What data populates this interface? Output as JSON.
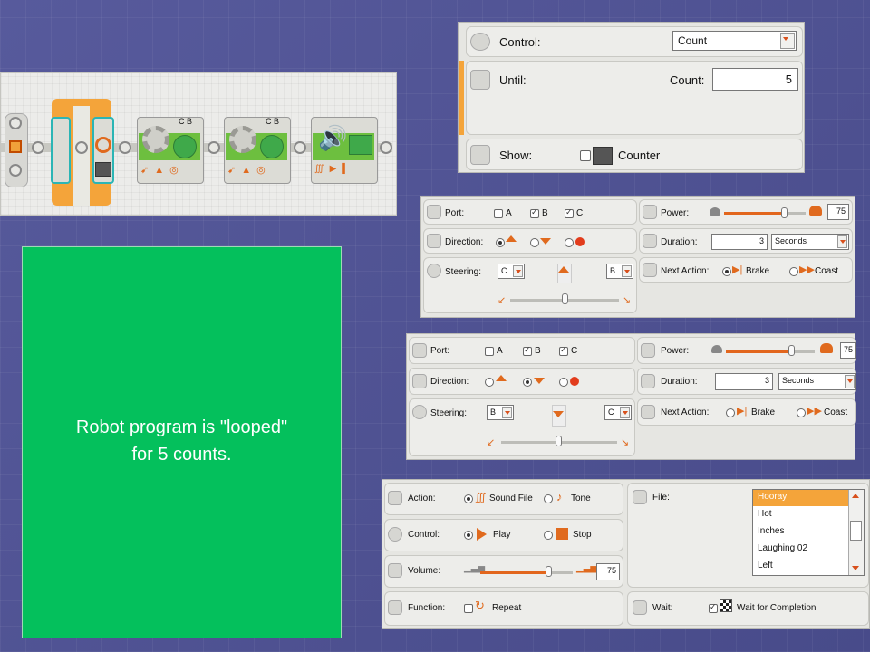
{
  "program": {
    "loop_sensor_ports": "C B",
    "move2_ports": "C B"
  },
  "loop_panel": {
    "control_label": "Control:",
    "control_value": "Count",
    "until_label": "Until:",
    "count_label": "Count:",
    "count_value": "5",
    "show_label": "Show:",
    "counter_label": "Counter"
  },
  "move1": {
    "port_label": "Port:",
    "ports": [
      "A",
      "B",
      "C"
    ],
    "power_label": "Power:",
    "power_value": "75",
    "direction_label": "Direction:",
    "duration_label": "Duration:",
    "duration_value": "3",
    "duration_unit": "Seconds",
    "steering_label": "Steering:",
    "steer_left": "C",
    "steer_right": "B",
    "next_action_label": "Next Action:",
    "brake_label": "Brake",
    "coast_label": "Coast"
  },
  "move2": {
    "port_label": "Port:",
    "ports": [
      "A",
      "B",
      "C"
    ],
    "power_label": "Power:",
    "power_value": "75",
    "direction_label": "Direction:",
    "duration_label": "Duration:",
    "duration_value": "3",
    "duration_unit": "Seconds",
    "steering_label": "Steering:",
    "steer_left": "B",
    "steer_right": "C",
    "next_action_label": "Next Action:",
    "brake_label": "Brake",
    "coast_label": "Coast"
  },
  "sound": {
    "action_label": "Action:",
    "sound_file_label": "Sound File",
    "tone_label": "Tone",
    "control_label": "Control:",
    "play_label": "Play",
    "stop_label": "Stop",
    "volume_label": "Volume:",
    "volume_value": "75",
    "function_label": "Function:",
    "repeat_label": "Repeat",
    "file_label": "File:",
    "files": [
      "Hooray",
      "Hot",
      "Inches",
      "Laughing 02",
      "Left"
    ],
    "wait_label": "Wait:",
    "wait_for_completion_label": "Wait for Completion"
  },
  "caption": {
    "line1": "Robot program is \"looped\"",
    "line2": "for 5 counts."
  },
  "colors": {
    "accent_orange": "#e2661d",
    "green_slide": "#04c05c",
    "block_green": "#6dbf3f"
  }
}
